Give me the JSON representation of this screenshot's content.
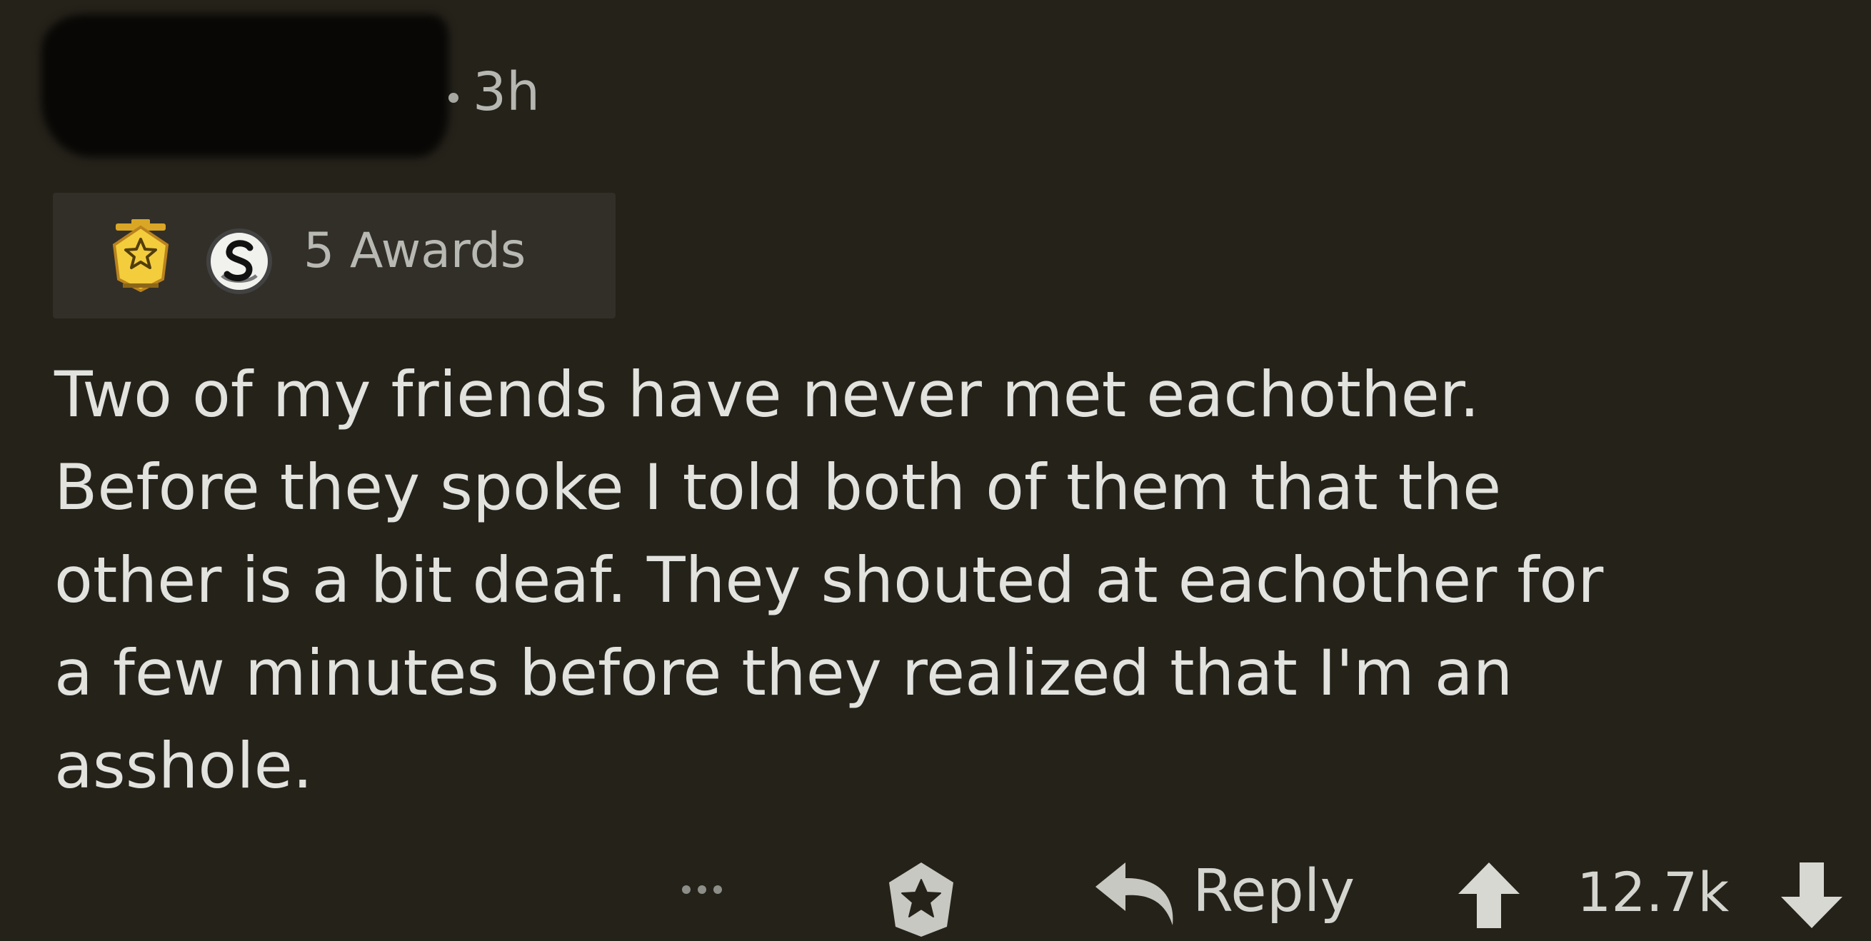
{
  "comment": {
    "author": "",
    "time": "3h",
    "awards": {
      "label": "5 Awards",
      "icons": [
        "gold-award-icon",
        "silver-award-icon"
      ]
    },
    "body": "Two of my friends have never met eachother.\nBefore they spoke I told both of them that the\nother is a bit deaf. They shouted at eachother for\na few minutes before they realized that I'm an\nasshole.",
    "actions": {
      "more_icon": "ellipsis-icon",
      "award_icon": "star-award-icon",
      "reply_icon": "reply-arrow-icon",
      "reply_label": "Reply",
      "upvote_icon": "upvote-arrow-icon",
      "score": "12.7k",
      "downvote_icon": "downvote-arrow-icon"
    }
  },
  "colors": {
    "background": "#25221a",
    "text": "#e2e2de",
    "muted_text": "#b7b7b2",
    "awards_background": "#322f28",
    "gold": "#f3cd3c"
  }
}
